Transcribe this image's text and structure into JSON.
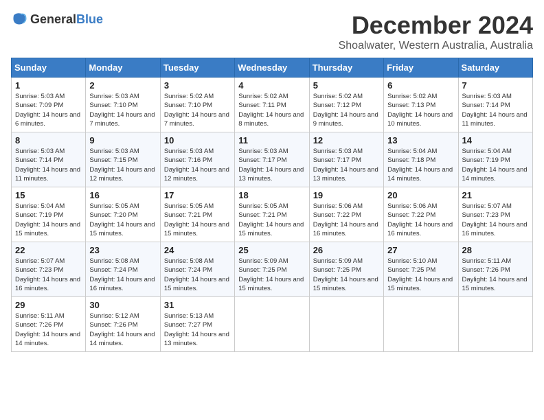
{
  "logo": {
    "general": "General",
    "blue": "Blue"
  },
  "title": {
    "month": "December 2024",
    "location": "Shoalwater, Western Australia, Australia"
  },
  "headers": [
    "Sunday",
    "Monday",
    "Tuesday",
    "Wednesday",
    "Thursday",
    "Friday",
    "Saturday"
  ],
  "weeks": [
    [
      {
        "day": "1",
        "sunrise": "5:03 AM",
        "sunset": "7:09 PM",
        "daylight": "14 hours and 6 minutes."
      },
      {
        "day": "2",
        "sunrise": "5:03 AM",
        "sunset": "7:10 PM",
        "daylight": "14 hours and 7 minutes."
      },
      {
        "day": "3",
        "sunrise": "5:02 AM",
        "sunset": "7:10 PM",
        "daylight": "14 hours and 7 minutes."
      },
      {
        "day": "4",
        "sunrise": "5:02 AM",
        "sunset": "7:11 PM",
        "daylight": "14 hours and 8 minutes."
      },
      {
        "day": "5",
        "sunrise": "5:02 AM",
        "sunset": "7:12 PM",
        "daylight": "14 hours and 9 minutes."
      },
      {
        "day": "6",
        "sunrise": "5:02 AM",
        "sunset": "7:13 PM",
        "daylight": "14 hours and 10 minutes."
      },
      {
        "day": "7",
        "sunrise": "5:03 AM",
        "sunset": "7:14 PM",
        "daylight": "14 hours and 11 minutes."
      }
    ],
    [
      {
        "day": "8",
        "sunrise": "5:03 AM",
        "sunset": "7:14 PM",
        "daylight": "14 hours and 11 minutes."
      },
      {
        "day": "9",
        "sunrise": "5:03 AM",
        "sunset": "7:15 PM",
        "daylight": "14 hours and 12 minutes."
      },
      {
        "day": "10",
        "sunrise": "5:03 AM",
        "sunset": "7:16 PM",
        "daylight": "14 hours and 12 minutes."
      },
      {
        "day": "11",
        "sunrise": "5:03 AM",
        "sunset": "7:17 PM",
        "daylight": "14 hours and 13 minutes."
      },
      {
        "day": "12",
        "sunrise": "5:03 AM",
        "sunset": "7:17 PM",
        "daylight": "14 hours and 13 minutes."
      },
      {
        "day": "13",
        "sunrise": "5:04 AM",
        "sunset": "7:18 PM",
        "daylight": "14 hours and 14 minutes."
      },
      {
        "day": "14",
        "sunrise": "5:04 AM",
        "sunset": "7:19 PM",
        "daylight": "14 hours and 14 minutes."
      }
    ],
    [
      {
        "day": "15",
        "sunrise": "5:04 AM",
        "sunset": "7:19 PM",
        "daylight": "14 hours and 15 minutes."
      },
      {
        "day": "16",
        "sunrise": "5:05 AM",
        "sunset": "7:20 PM",
        "daylight": "14 hours and 15 minutes."
      },
      {
        "day": "17",
        "sunrise": "5:05 AM",
        "sunset": "7:21 PM",
        "daylight": "14 hours and 15 minutes."
      },
      {
        "day": "18",
        "sunrise": "5:05 AM",
        "sunset": "7:21 PM",
        "daylight": "14 hours and 15 minutes."
      },
      {
        "day": "19",
        "sunrise": "5:06 AM",
        "sunset": "7:22 PM",
        "daylight": "14 hours and 16 minutes."
      },
      {
        "day": "20",
        "sunrise": "5:06 AM",
        "sunset": "7:22 PM",
        "daylight": "14 hours and 16 minutes."
      },
      {
        "day": "21",
        "sunrise": "5:07 AM",
        "sunset": "7:23 PM",
        "daylight": "14 hours and 16 minutes."
      }
    ],
    [
      {
        "day": "22",
        "sunrise": "5:07 AM",
        "sunset": "7:23 PM",
        "daylight": "14 hours and 16 minutes."
      },
      {
        "day": "23",
        "sunrise": "5:08 AM",
        "sunset": "7:24 PM",
        "daylight": "14 hours and 16 minutes."
      },
      {
        "day": "24",
        "sunrise": "5:08 AM",
        "sunset": "7:24 PM",
        "daylight": "14 hours and 15 minutes."
      },
      {
        "day": "25",
        "sunrise": "5:09 AM",
        "sunset": "7:25 PM",
        "daylight": "14 hours and 15 minutes."
      },
      {
        "day": "26",
        "sunrise": "5:09 AM",
        "sunset": "7:25 PM",
        "daylight": "14 hours and 15 minutes."
      },
      {
        "day": "27",
        "sunrise": "5:10 AM",
        "sunset": "7:25 PM",
        "daylight": "14 hours and 15 minutes."
      },
      {
        "day": "28",
        "sunrise": "5:11 AM",
        "sunset": "7:26 PM",
        "daylight": "14 hours and 15 minutes."
      }
    ],
    [
      {
        "day": "29",
        "sunrise": "5:11 AM",
        "sunset": "7:26 PM",
        "daylight": "14 hours and 14 minutes."
      },
      {
        "day": "30",
        "sunrise": "5:12 AM",
        "sunset": "7:26 PM",
        "daylight": "14 hours and 14 minutes."
      },
      {
        "day": "31",
        "sunrise": "5:13 AM",
        "sunset": "7:27 PM",
        "daylight": "14 hours and 13 minutes."
      },
      null,
      null,
      null,
      null
    ]
  ],
  "labels": {
    "sunrise": "Sunrise:",
    "sunset": "Sunset:",
    "daylight": "Daylight hours"
  }
}
